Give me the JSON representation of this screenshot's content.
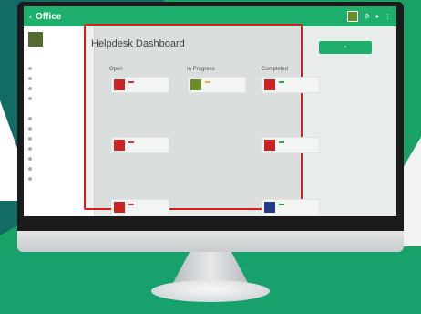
{
  "app": {
    "brand": "Office",
    "search_placeholder": ""
  },
  "page": {
    "title": "Helpdesk Dashboard",
    "add_button": "+"
  },
  "columns": [
    {
      "title": "Open"
    },
    {
      "title": "In Progress"
    },
    {
      "title": "Completed"
    }
  ],
  "colors": {
    "topbar": "#1eaf6c",
    "highlight": "#e0191b",
    "badge_red": "#d33",
    "badge_yellow": "#f0b429",
    "badge_green": "#28a745"
  }
}
